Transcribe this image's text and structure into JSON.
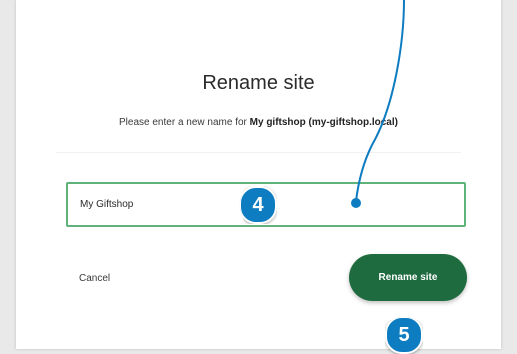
{
  "dialog": {
    "title": "Rename site",
    "subtitle_prefix": "Please enter a new name for ",
    "subtitle_site": "My giftshop (my-giftshop.local)"
  },
  "form": {
    "site_name_value": "My Giftshop",
    "cancel_label": "Cancel",
    "rename_label": "Rename site"
  },
  "callouts": {
    "step_4": "4",
    "step_5": "5"
  },
  "colors": {
    "primary_button": "#1f6b40",
    "field_border_active": "#5fb37a",
    "callout": "#0e7cc0"
  }
}
